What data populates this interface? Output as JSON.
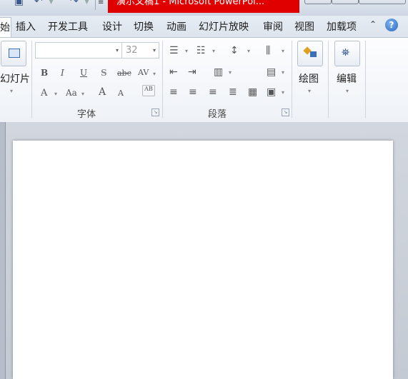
{
  "window": {
    "title": "演示文稿1 - Microsoft PowerPoi...",
    "buttons": [
      "minimize",
      "maximize",
      "close"
    ]
  },
  "quick_access": {
    "icons": [
      "save-icon",
      "undo-icon",
      "redo-icon",
      "customize-icon"
    ]
  },
  "tabs": {
    "home_partial": "始",
    "items": [
      "插入",
      "开发工具",
      "设计",
      "切换",
      "动画",
      "幻灯片放映",
      "审阅",
      "视图",
      "加载项"
    ],
    "help": "?"
  },
  "ribbon": {
    "slides": {
      "label": "幻灯片",
      "caret": "▾"
    },
    "font": {
      "group_label": "字体",
      "font_name_value": "",
      "font_size_value": "32",
      "bold": "B",
      "italic": "I",
      "underline": "U",
      "shadow": "S",
      "strike": "abc",
      "spacing": "AV",
      "color": "A",
      "case": "Aa",
      "grow": "A",
      "shrink": "A"
    },
    "paragraph": {
      "group_label": "段落"
    },
    "drawing": {
      "label": "绘图",
      "caret": "▾"
    },
    "editing": {
      "label": "编辑",
      "caret": "▾"
    }
  }
}
